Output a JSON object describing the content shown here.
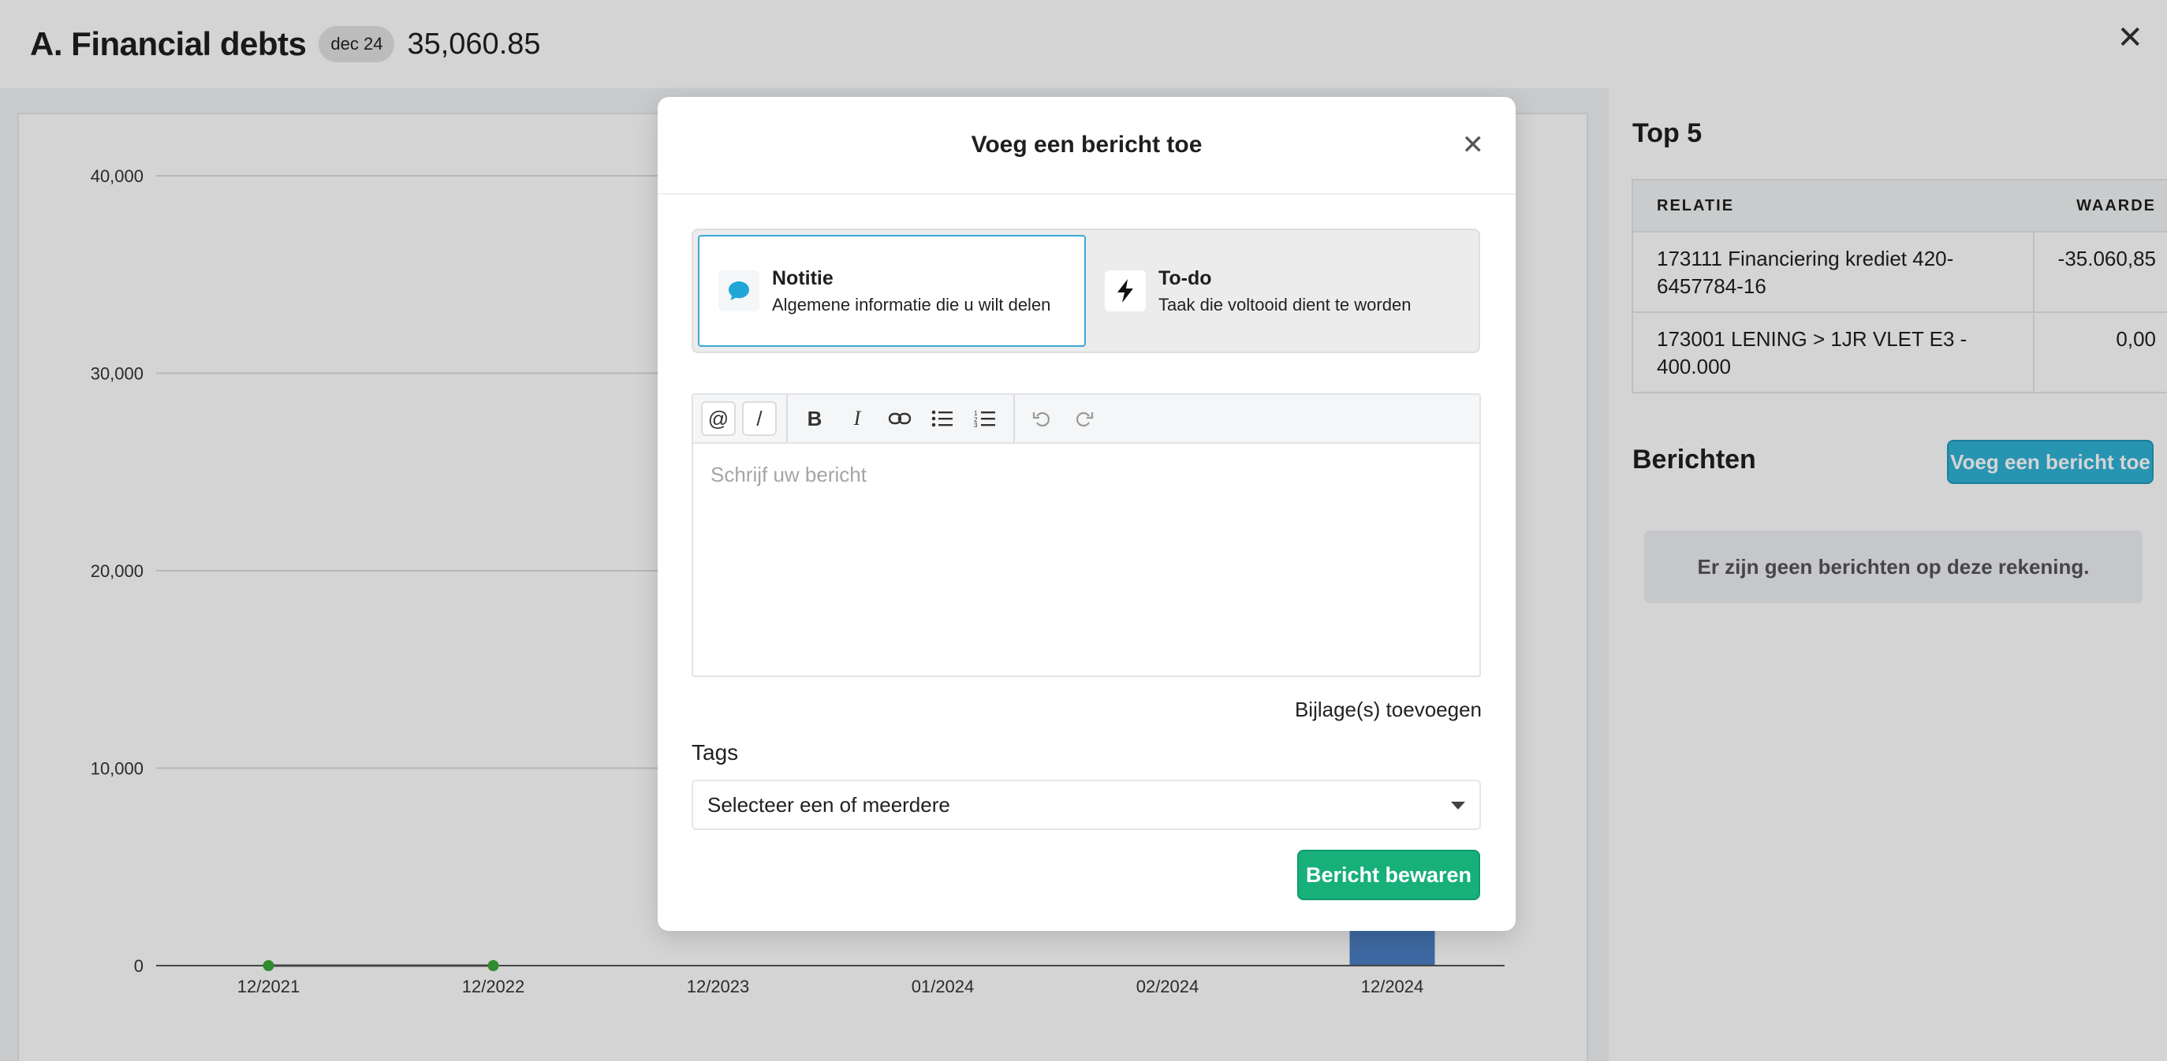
{
  "header": {
    "title": "A. Financial debts",
    "badge": "dec 24",
    "amount": "35,060.85",
    "close_icon": "close-icon"
  },
  "chart_data": {
    "type": "bar",
    "categories": [
      "12/2021",
      "12/2022",
      "12/2023",
      "01/2024",
      "02/2024",
      "12/2024"
    ],
    "values": [
      0,
      0,
      null,
      null,
      null,
      35060.85
    ],
    "line_points": [
      {
        "x": "12/2021",
        "y": 0
      },
      {
        "x": "12/2022",
        "y": 0
      }
    ],
    "yticks": [
      "40,000",
      "30,000",
      "20,000",
      "10,000",
      "0"
    ],
    "ytick_values": [
      40000,
      30000,
      20000,
      10000,
      0
    ],
    "ylim": [
      0,
      40000
    ],
    "grid": true,
    "colors": {
      "bar": "#4a7ec2",
      "line": "#a9a9a9",
      "point": "#3aa83a",
      "grid": "#dcdcdc"
    }
  },
  "right": {
    "top5_title": "Top 5",
    "columns": [
      "RELATIE",
      "WAARDE"
    ],
    "rows": [
      {
        "relatie": "173111 Financiering krediet 420-6457784-16",
        "waarde": "-35.060,85"
      },
      {
        "relatie": "173001 LENING > 1JR VLET E3 - 400.000",
        "waarde": "0,00"
      }
    ],
    "messages_title": "Berichten",
    "add_message_label": "Voeg een bericht toe",
    "empty_text": "Er zijn geen berichten op deze rekening."
  },
  "modal": {
    "title": "Voeg een bericht toe",
    "types": [
      {
        "title": "Notitie",
        "subtitle": "Algemene informatie die u wilt delen",
        "icon": "speech-bubble-icon",
        "active": true
      },
      {
        "title": "To-do",
        "subtitle": "Taak die voltooid dient te worden",
        "icon": "lightning-bolt-icon",
        "active": false
      }
    ],
    "toolbar": {
      "mention": "@",
      "slash": "/",
      "bold": "B",
      "italic": "I"
    },
    "placeholder": "Schrijf uw bericht",
    "attach_label": "Bijlage(s) toevoegen",
    "tags_label": "Tags",
    "tags_placeholder": "Selecteer een of meerdere",
    "save_label": "Bericht bewaren"
  },
  "colors": {
    "primary_button": "#17b07a",
    "info_button": "#2fb3d6",
    "active_border": "#3da7d6"
  }
}
